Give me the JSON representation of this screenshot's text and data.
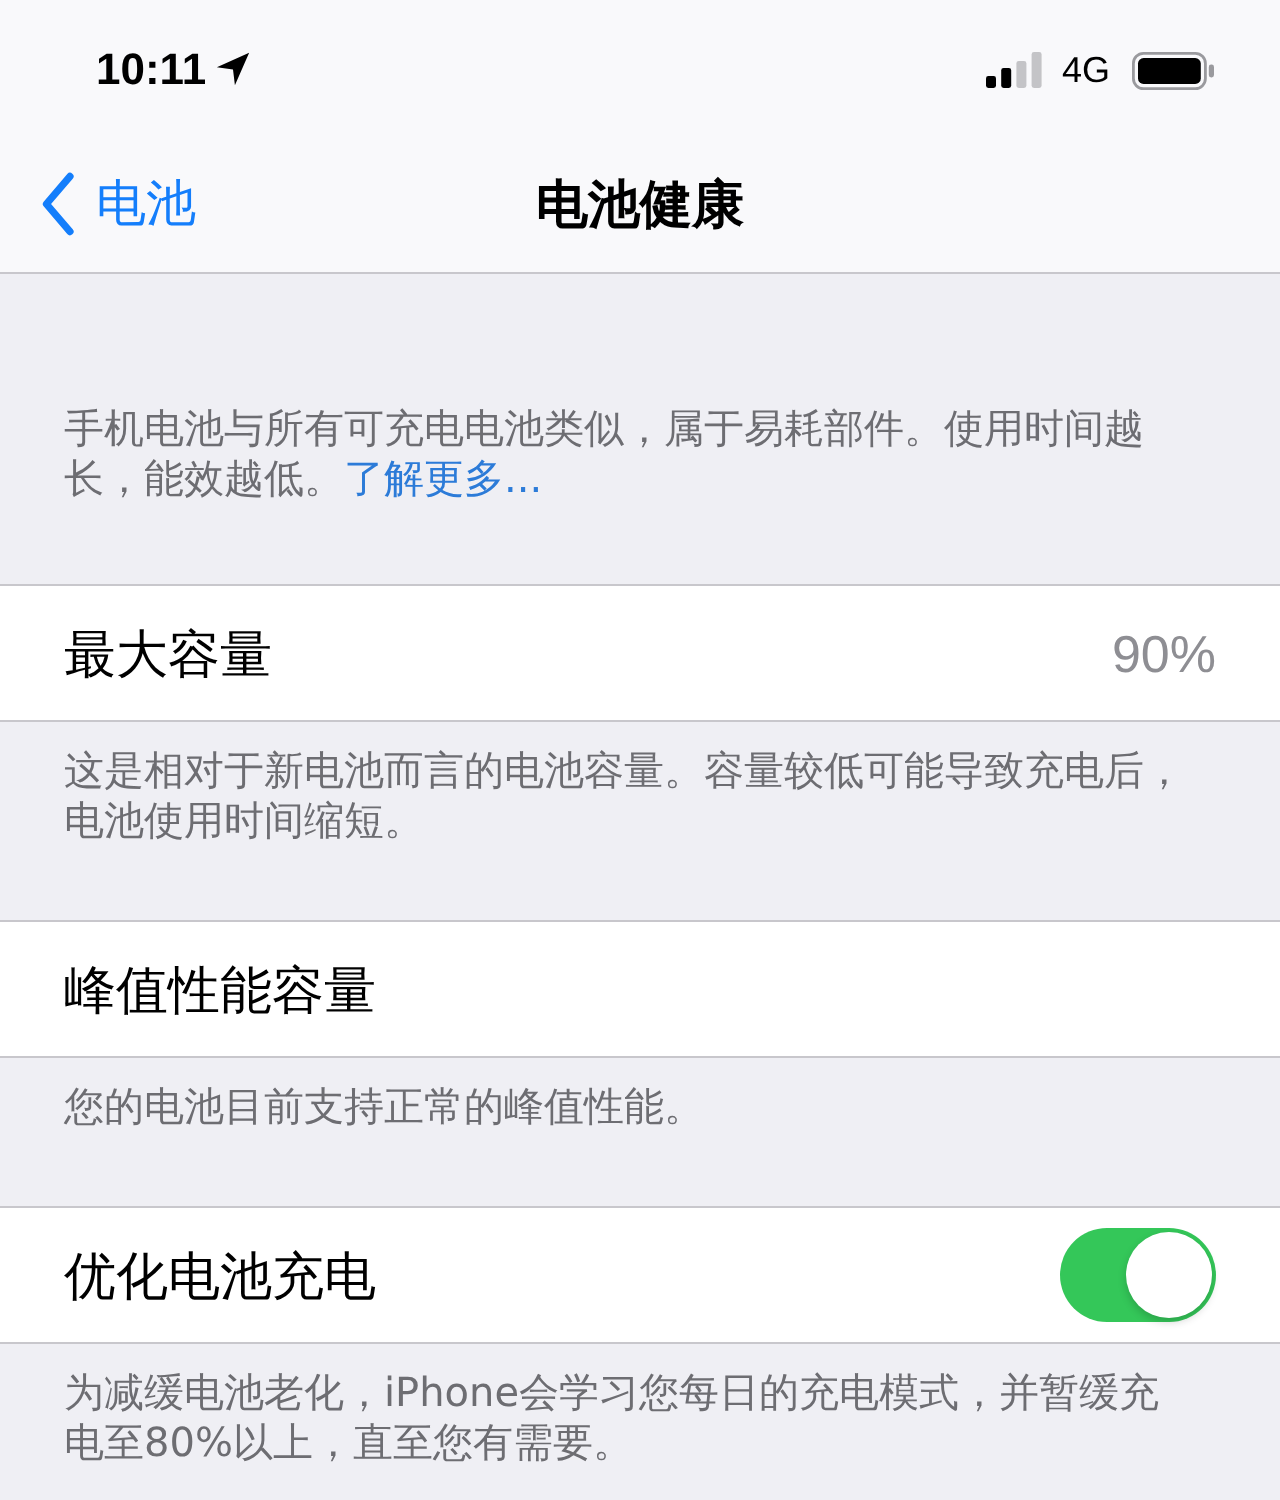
{
  "status_bar": {
    "time": "10:11",
    "network": "4G"
  },
  "nav_bar": {
    "back_label": "电池",
    "title": "电池健康"
  },
  "intro": {
    "text": "手机电池与所有可充电电池类似，属于易耗部件。使用时间越长，能效越低。",
    "link": "了解更多..."
  },
  "settings": [
    {
      "kind": "value",
      "label": "最大容量",
      "value": "90%",
      "note": "这是相对于新电池而言的电池容量。容量较低可能导致充电后，电池使用时间缩短。"
    },
    {
      "kind": "plain",
      "label": "峰值性能容量",
      "note": "您的电池目前支持正常的峰值性能。"
    },
    {
      "kind": "toggle",
      "label": "优化电池充电",
      "on": true,
      "note": "为减缓电池老化，iPhone会学习您每日的充电模式，并暂缓充电至80%以上，直至您有需要。"
    }
  ]
}
